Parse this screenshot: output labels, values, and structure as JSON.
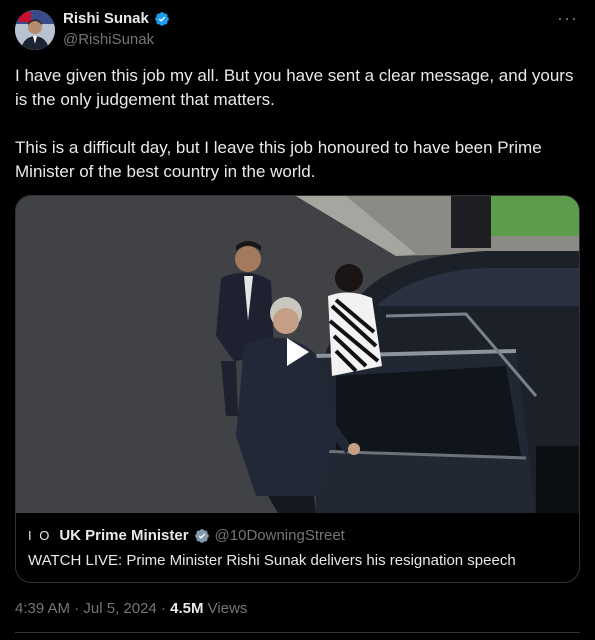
{
  "author": {
    "name": "Rishi Sunak",
    "handle": "@RishiSunak",
    "verified": true,
    "badge_color": "#1d9bf0"
  },
  "more_icon": "more-horizontal-icon",
  "tweet": {
    "paragraphs": [
      "I have given this job my all. But you have sent a clear message, and yours is the only judgement that matters.",
      "This is a difficult day, but I leave this job honoured to have been Prime Minister of the best country in the world."
    ]
  },
  "media_card": {
    "video": {
      "play_icon": "play-icon"
    },
    "source": {
      "logo": "I O",
      "name": "UK Prime Minister",
      "verified_badge": "gray-verified-icon",
      "handle": "@10DowningStreet"
    },
    "caption": "WATCH LIVE: Prime Minister Rishi Sunak delivers his resignation speech"
  },
  "meta": {
    "time": "4:39 AM",
    "separator": "·",
    "date": "Jul 5, 2024",
    "views_count": "4.5M",
    "views_label": "Views"
  }
}
